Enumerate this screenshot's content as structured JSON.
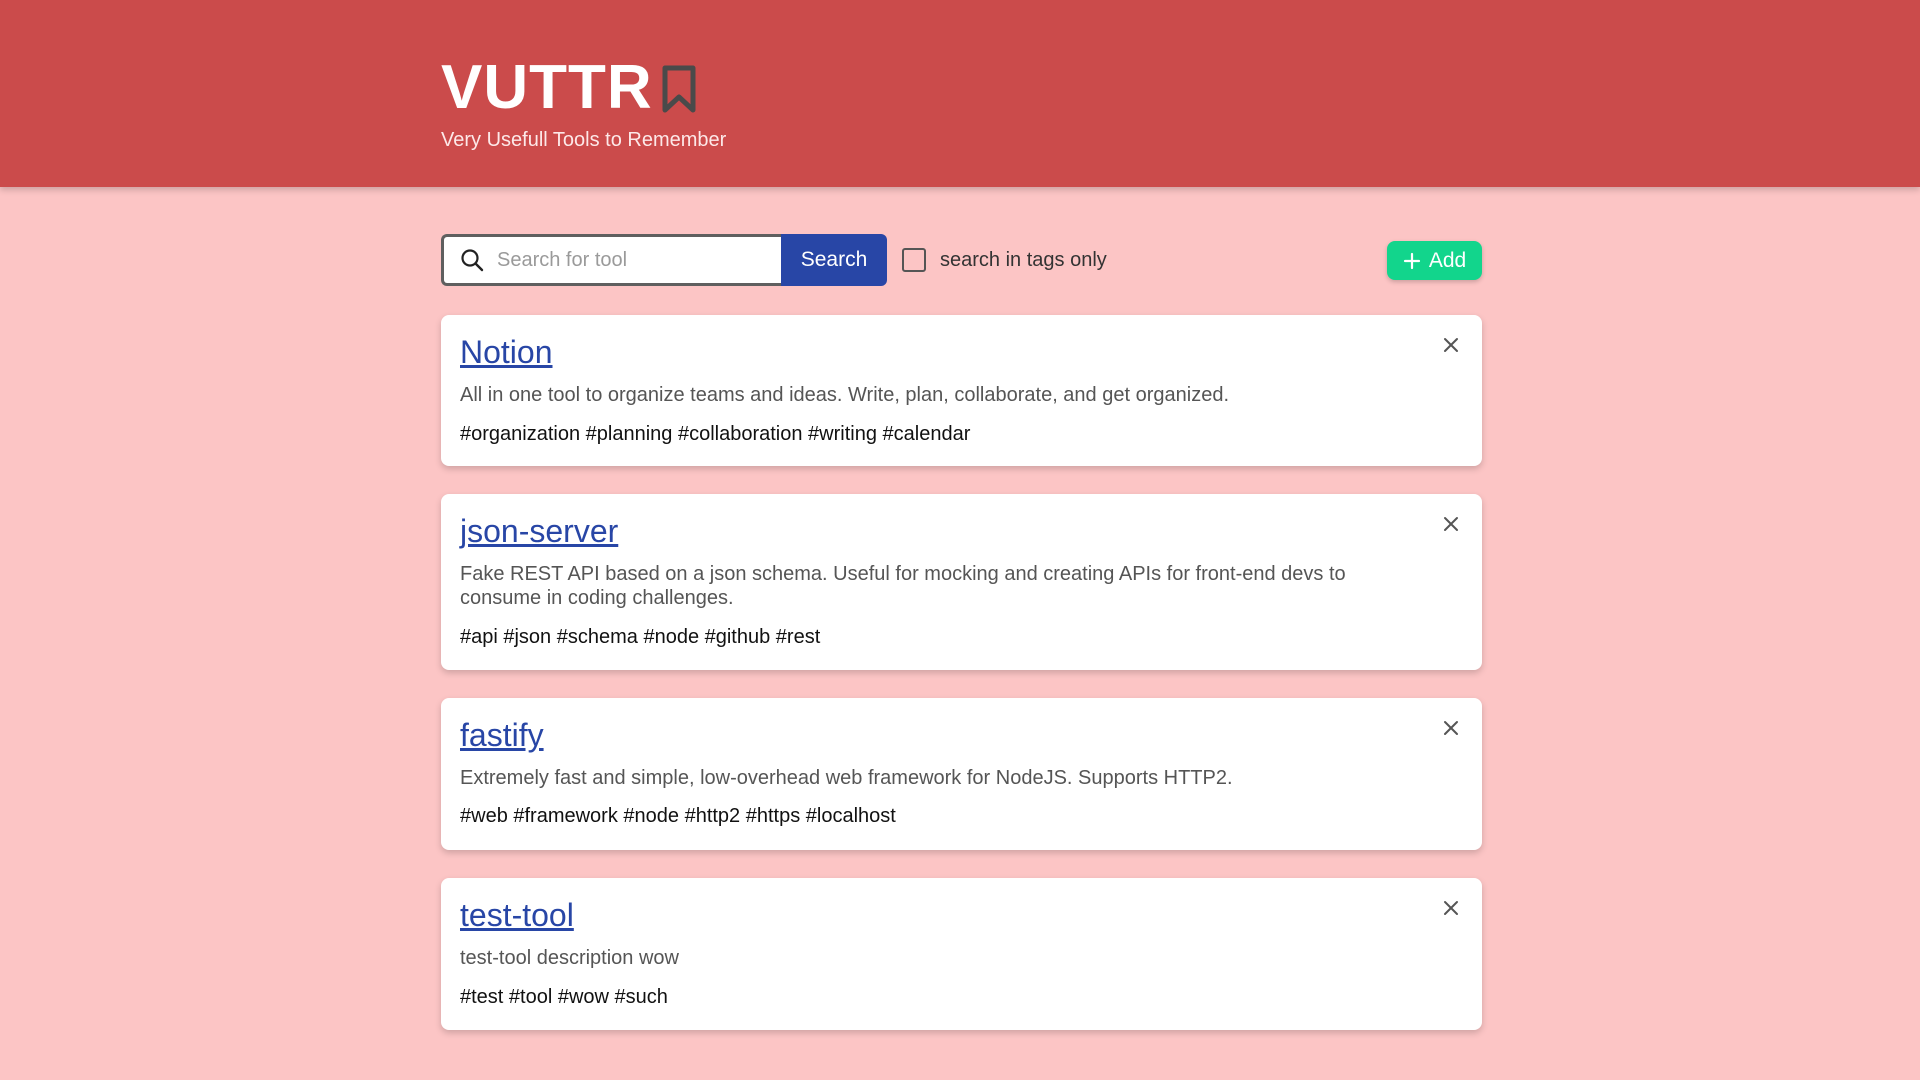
{
  "header": {
    "title": "VUTTR",
    "subtitle": "Very Usefull Tools to Remember",
    "icon": "bookmark-icon",
    "background_color": "#cb4b4b"
  },
  "toolbar": {
    "search_placeholder": "Search for tool",
    "search_value": "",
    "search_button_label": "Search",
    "tags_only_label": "search in tags only",
    "tags_only_checked": false,
    "add_button_label": "Add",
    "add_button_color": "#12d58c",
    "search_button_color": "#2846a6"
  },
  "tools": [
    {
      "title": "Notion",
      "description": "All in one tool to organize teams and ideas. Write, plan, collaborate, and get organized.",
      "tags": "#organization #planning #collaboration #writing #calendar"
    },
    {
      "title": "json-server",
      "description": "Fake REST API based on a json schema. Useful for mocking and creating APIs for front-end devs to consume in coding challenges.",
      "tags": "#api #json #schema #node #github #rest"
    },
    {
      "title": "fastify",
      "description": "Extremely fast and simple, low-overhead web framework for NodeJS. Supports HTTP2.",
      "tags": "#web #framework #node #http2 #https #localhost"
    },
    {
      "title": "test-tool",
      "description": "test-tool description wow",
      "tags": "#test #tool #wow #such"
    }
  ],
  "page_background": "#fcc5c5"
}
